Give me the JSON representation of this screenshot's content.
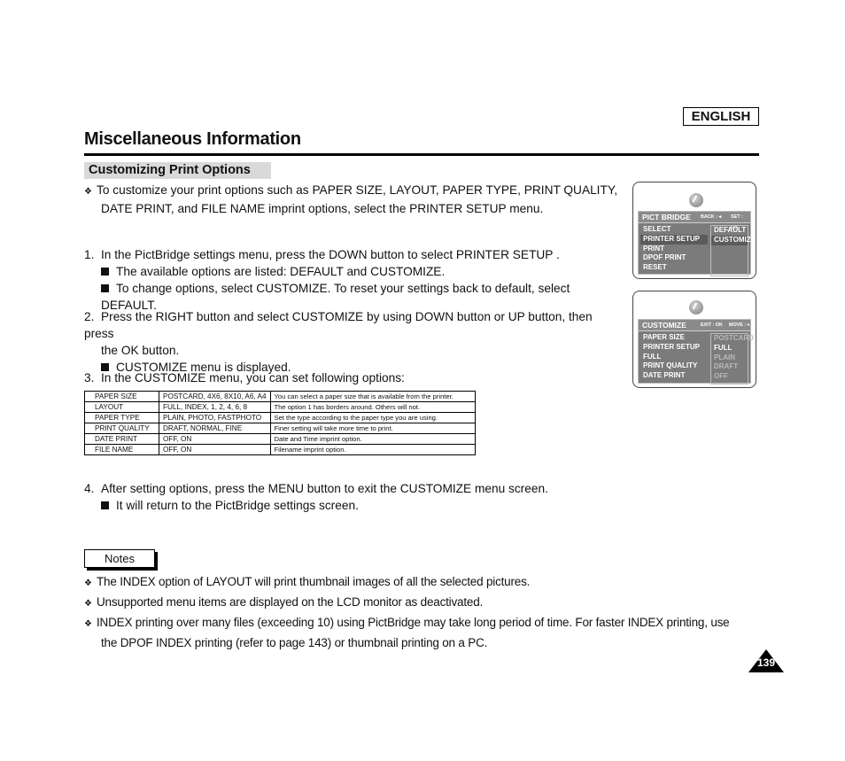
{
  "header": {
    "language": "ENGLISH",
    "title": "Miscellaneous Information",
    "section": "Customizing Print Options"
  },
  "intro": {
    "bullet": "❖",
    "lines": [
      "To customize your print options such as PAPER SIZE, LAYOUT, PAPER TYPE, PRINT QUALITY,",
      "DATE PRINT, and FILE NAME imprint options, select the PRINTER SETUP menu."
    ]
  },
  "steps": [
    {
      "num": "1.",
      "text": "In the PictBridge settings menu, press the DOWN button to select  PRINTER SETUP .",
      "subs": [
        "The available options are listed: DEFAULT and CUSTOMIZE.",
        "To change options, select CUSTOMIZE. To reset your settings back to default, select DEFAULT."
      ]
    },
    {
      "num": "2.",
      "text_lines": [
        "Press the RIGHT button and select CUSTOMIZE by using DOWN button or UP button, then press",
        "the OK button."
      ],
      "subs": [
        "CUSTOMIZE menu is displayed."
      ]
    },
    {
      "num": "3.",
      "text": "In the CUSTOMIZE menu, you can set following options:"
    },
    {
      "num": "4.",
      "text": "After setting options, press the MENU button to exit the CUSTOMIZE menu screen.",
      "subs": [
        "It will return to the PictBridge settings screen."
      ]
    }
  ],
  "options_table": {
    "rows": [
      [
        "PAPER SIZE",
        "POSTCARD, 4X6, 8X10, A6, A4",
        "You can select a paper size that is available from the printer."
      ],
      [
        "LAYOUT",
        "FULL, INDEX, 1, 2, 4, 6, 8",
        "The option  1  has borders around. Others will not."
      ],
      [
        "PAPER TYPE",
        "PLAIN, PHOTO, FASTPHOTO",
        "Set the type according to the paper type you are using."
      ],
      [
        "PRINT QUALITY",
        "DRAFT, NORMAL, FINE",
        "Finer setting will take more time to print."
      ],
      [
        "DATE PRINT",
        "OFF, ON",
        "Date and Time imprint option."
      ],
      [
        "FILE NAME",
        "OFF, ON",
        "Filename imprint option."
      ]
    ]
  },
  "notes": {
    "label": "Notes",
    "bullet": "❖",
    "items": [
      "The  INDEX  option of LAYOUT will print thumbnail images of all the selected pictures.",
      "Unsupported menu items are displayed on the LCD monitor as deactivated.",
      "INDEX printing over many files (exceeding 10) using PictBridge may take long period of time. For faster INDEX printing, use",
      "the DPOF INDEX printing (refer to page 143) or thumbnail printing on a PC."
    ]
  },
  "screens": {
    "pictbridge": {
      "title": "PICT BRIDGE",
      "hint_left": "BACK : ◂",
      "hint_right": "SET : OK",
      "menu": [
        "SELECT",
        "PRINTER SETUP",
        "PRINT",
        "DPOF PRINT",
        "RESET"
      ],
      "selected": "PRINTER SETUP",
      "options": [
        "DEFAULT",
        "CUSTOMIZE"
      ],
      "selected_option": "CUSTOMIZE"
    },
    "customize": {
      "title": "CUSTOMIZE",
      "hint_left": "EXIT : OK",
      "hint_right": "MOVE : ♦",
      "menu": [
        "PAPER SIZE",
        "PRINTER SETUP",
        "FULL",
        "PRINT QUALITY",
        "DATE PRINT"
      ],
      "values": [
        "POSTCARD",
        "FULL",
        "PLAIN",
        "DRAFT",
        "OFF"
      ]
    }
  },
  "page": {
    "number": "139"
  }
}
